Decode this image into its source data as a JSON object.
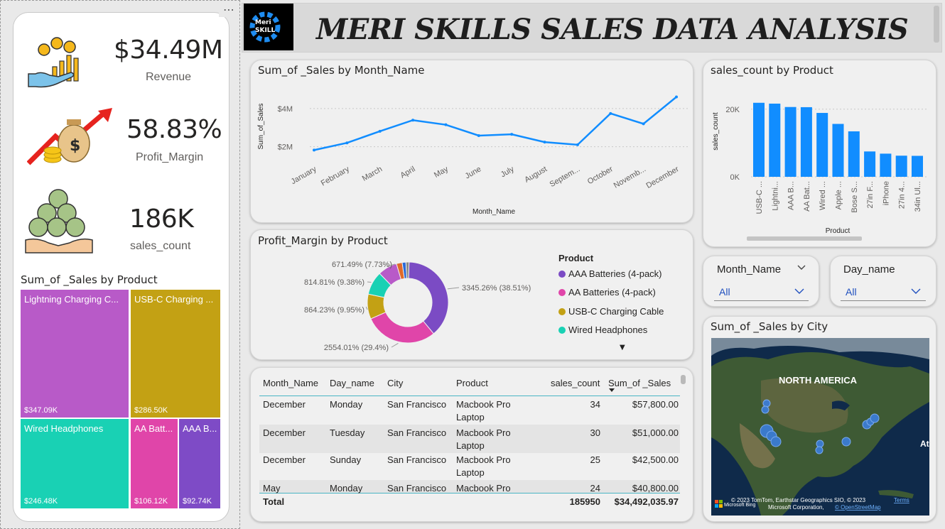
{
  "header": {
    "title": "MERI SKILLS SALES DATA ANALYSIS",
    "logo_line1": "Meri",
    "logo_line2": "SKILL"
  },
  "menu_icon": "⋯",
  "kpis": {
    "revenue": {
      "value": "$34.49M",
      "label": "Revenue"
    },
    "profit": {
      "value": "58.83%",
      "label": "Profit_Margin"
    },
    "count": {
      "value": "186K",
      "label": "sales_count"
    }
  },
  "treemap": {
    "title": "Sum_of _Sales by Product",
    "tiles": [
      {
        "name": "Lightning Charging C...",
        "value": "$347.09K",
        "color": "#b85ac8"
      },
      {
        "name": "USB-C Charging ...",
        "value": "$286.50K",
        "color": "#c3a114"
      },
      {
        "name": "Wired Headphones",
        "value": "$246.48K",
        "color": "#19d1b4"
      },
      {
        "name": "AA Batt...",
        "value": "$106.12K",
        "color": "#e045a9"
      },
      {
        "name": "AAA B...",
        "value": "$92.74K",
        "color": "#7e4bc6"
      }
    ]
  },
  "line_chart": {
    "title": "Sum_of _Sales by Month_Name",
    "xlabel": "Month_Name",
    "ylabel": "Sum_of_Sales",
    "yticks": [
      "$4M",
      "$2M"
    ],
    "color": "#118dff"
  },
  "bar_chart": {
    "title": "sales_count by Product",
    "xlabel": "Product",
    "ylabel": "sales_count",
    "yticks": [
      "20K",
      "0K"
    ],
    "color": "#118dff"
  },
  "donut": {
    "title": "Profit_Margin by Product",
    "legend_title": "Product",
    "legend": [
      {
        "label": "AAA Batteries (4-pack)",
        "color": "#7b4bc4"
      },
      {
        "label": "AA Batteries (4-pack)",
        "color": "#e045a9"
      },
      {
        "label": "USB-C Charging Cable",
        "color": "#c3a114"
      },
      {
        "label": "Wired Headphones",
        "color": "#19d1b4"
      }
    ],
    "labels": [
      "3345.26% (38.51%)",
      "2554.01% (29.4%)",
      "864.23% (9.95%)",
      "814.81% (9.38%)",
      "671.49% (7.73%)"
    ],
    "more_icon": "▼"
  },
  "slicers": {
    "month": {
      "label": "Month_Name",
      "value": "All"
    },
    "day": {
      "label": "Day_name",
      "value": "All"
    }
  },
  "map": {
    "title": "Sum_of _Sales by City",
    "region_label": "NORTH AMERICA",
    "attribution1": "© 2023 TomTom, Earthstar Geographics SIO, © 2023",
    "attribution_link1": "Terms",
    "attribution2": "Microsoft Corporation,",
    "attribution_link2": "© OpenStreetMap",
    "brand": "Microsoft Bing",
    "edge_label": "At"
  },
  "table": {
    "columns": [
      "Month_Name",
      "Day_name",
      "City",
      "Product",
      "sales_count",
      "Sum_of _Sales"
    ],
    "rows": [
      {
        "month": "December",
        "day": "Monday",
        "city": "San Francisco",
        "product1": "Macbook Pro",
        "product2": "Laptop",
        "count": "34",
        "sales": "$57,800.00"
      },
      {
        "month": "December",
        "day": "Tuesday",
        "city": "San Francisco",
        "product1": "Macbook Pro",
        "product2": "Laptop",
        "count": "30",
        "sales": "$51,000.00"
      },
      {
        "month": "December",
        "day": "Sunday",
        "city": "San Francisco",
        "product1": "Macbook Pro",
        "product2": "Laptop",
        "count": "25",
        "sales": "$42,500.00"
      },
      {
        "month": "May",
        "day": "Monday",
        "city": "San Francisco",
        "product1": "Macbook Pro",
        "product2": "",
        "count": "24",
        "sales": "$40,800.00"
      }
    ],
    "total": {
      "label": "Total",
      "count": "185950",
      "sales": "$34,492,035.97"
    }
  },
  "chart_data": [
    {
      "type": "line",
      "title": "Sum_of _Sales by Month_Name",
      "xlabel": "Month_Name",
      "ylabel": "Sum_of_Sales",
      "x": [
        "January",
        "February",
        "March",
        "April",
        "May",
        "June",
        "July",
        "August",
        "Septem...",
        "October",
        "Novemb...",
        "December"
      ],
      "values": [
        1.82,
        2.2,
        2.81,
        3.39,
        3.15,
        2.58,
        2.65,
        2.24,
        2.1,
        3.74,
        3.2,
        4.61
      ],
      "ylim": [
        1.5,
        5.0
      ],
      "y_unit": "$M",
      "grid": true
    },
    {
      "type": "bar",
      "title": "sales_count by Product",
      "xlabel": "Product",
      "ylabel": "sales_count",
      "categories": [
        "USB-C ...",
        "Lightni...",
        "AAA B...",
        "AA Bat...",
        "Wired ...",
        "Apple ...",
        "Bose S...",
        "27in F...",
        "iPhone",
        "27in 4...",
        "34in Ul..."
      ],
      "values": [
        21900,
        21650,
        20650,
        20600,
        18900,
        15650,
        13450,
        7500,
        6850,
        6250,
        6200
      ],
      "ylim": [
        0,
        25000
      ],
      "grid": true
    },
    {
      "type": "pie",
      "title": "Profit_Margin by Product",
      "labels": [
        "AAA Batteries (4-pack)",
        "AA Batteries (4-pack)",
        "USB-C Charging Cable",
        "Wired Headphones",
        "",
        "",
        "",
        ""
      ],
      "values": [
        38.51,
        29.4,
        9.95,
        9.38,
        7.73,
        2.3,
        1.5,
        1.23
      ],
      "colors": [
        "#7b4bc4",
        "#e045a9",
        "#c3a114",
        "#19d1b4",
        "#b85ac8",
        "#e06a2a",
        "#2a6ad8",
        "#888888"
      ]
    }
  ]
}
